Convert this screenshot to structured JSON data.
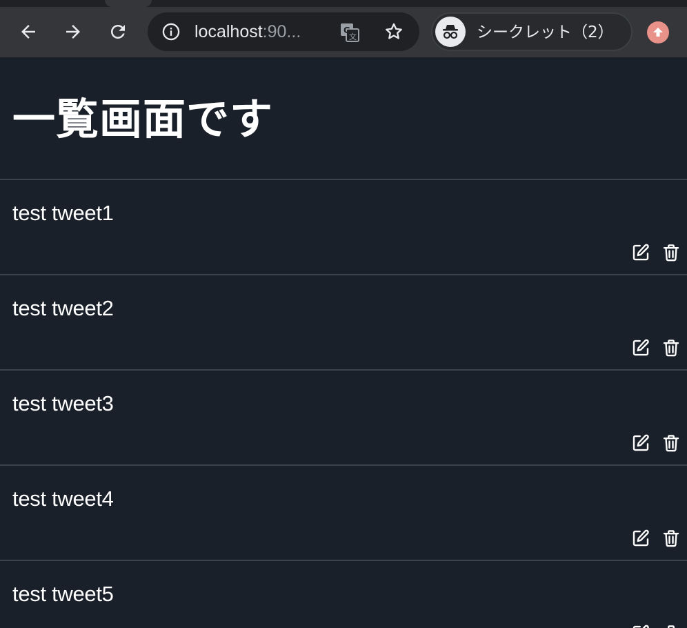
{
  "browser": {
    "url_host": "localhost",
    "url_rest": ":90...",
    "incognito_label": "シークレット（2）",
    "icons": {
      "back": "arrow-left-icon",
      "forward": "arrow-right-icon",
      "reload": "reload-icon",
      "site_info": "info-icon",
      "translate": "translate-icon",
      "bookmark": "star-icon",
      "incognito": "incognito-icon",
      "update": "update-arrow-icon"
    }
  },
  "page": {
    "title": "一覧画面です"
  },
  "tweets": [
    {
      "text": "test tweet1"
    },
    {
      "text": "test tweet2"
    },
    {
      "text": "test tweet3"
    },
    {
      "text": "test tweet4"
    },
    {
      "text": "test tweet5"
    }
  ],
  "actions": {
    "edit_icon": "edit-icon",
    "delete_icon": "trash-icon"
  },
  "colors": {
    "page_background": "#1a2029",
    "divider": "#3d434c",
    "chrome_toolbar": "#35363a",
    "omnibox": "#202124",
    "update_badge": "#e8928a",
    "text": "#ffffff"
  }
}
